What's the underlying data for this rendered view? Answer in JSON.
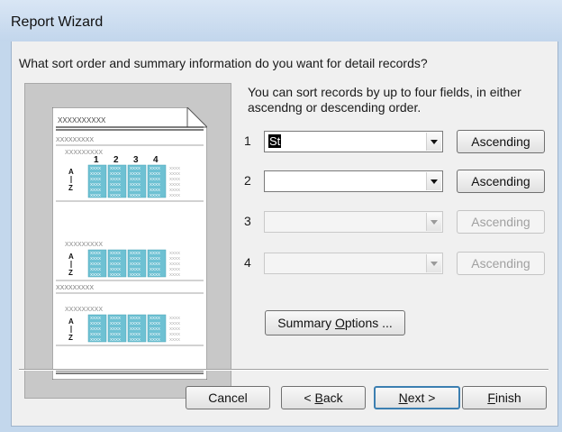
{
  "window": {
    "title": "Report Wizard"
  },
  "question": "What sort order and summary information do you want for detail records?",
  "instructions": "You can sort records by up to four fields, in either ascendng or descending order.",
  "sort_rows": [
    {
      "number": "1",
      "value": "St",
      "enabled": true,
      "order": "Ascending"
    },
    {
      "number": "2",
      "value": "",
      "enabled": true,
      "order": "Ascending"
    },
    {
      "number": "3",
      "value": "",
      "enabled": false,
      "order": "Ascending"
    },
    {
      "number": "4",
      "value": "",
      "enabled": false,
      "order": "Ascending"
    }
  ],
  "summary_button": {
    "label_pre": "Summary ",
    "label_accel": "O",
    "label_post": "ptions ..."
  },
  "footer": {
    "cancel": "Cancel",
    "back_pre": "< ",
    "back_accel": "B",
    "back_post": "ack",
    "next_pre": "",
    "next_accel": "N",
    "next_post": "ext >",
    "finish_pre": "",
    "finish_accel": "F",
    "finish_post": "inish"
  },
  "preview": {
    "placeholder_text": "XXXXXXXXXX",
    "placeholder_short": "XXXXXXXXX",
    "column_numbers": [
      "1",
      "2",
      "3",
      "4"
    ],
    "sort_glyph_top": "A",
    "sort_glyph_bottom": "Z",
    "cell_text": "XXXX"
  }
}
